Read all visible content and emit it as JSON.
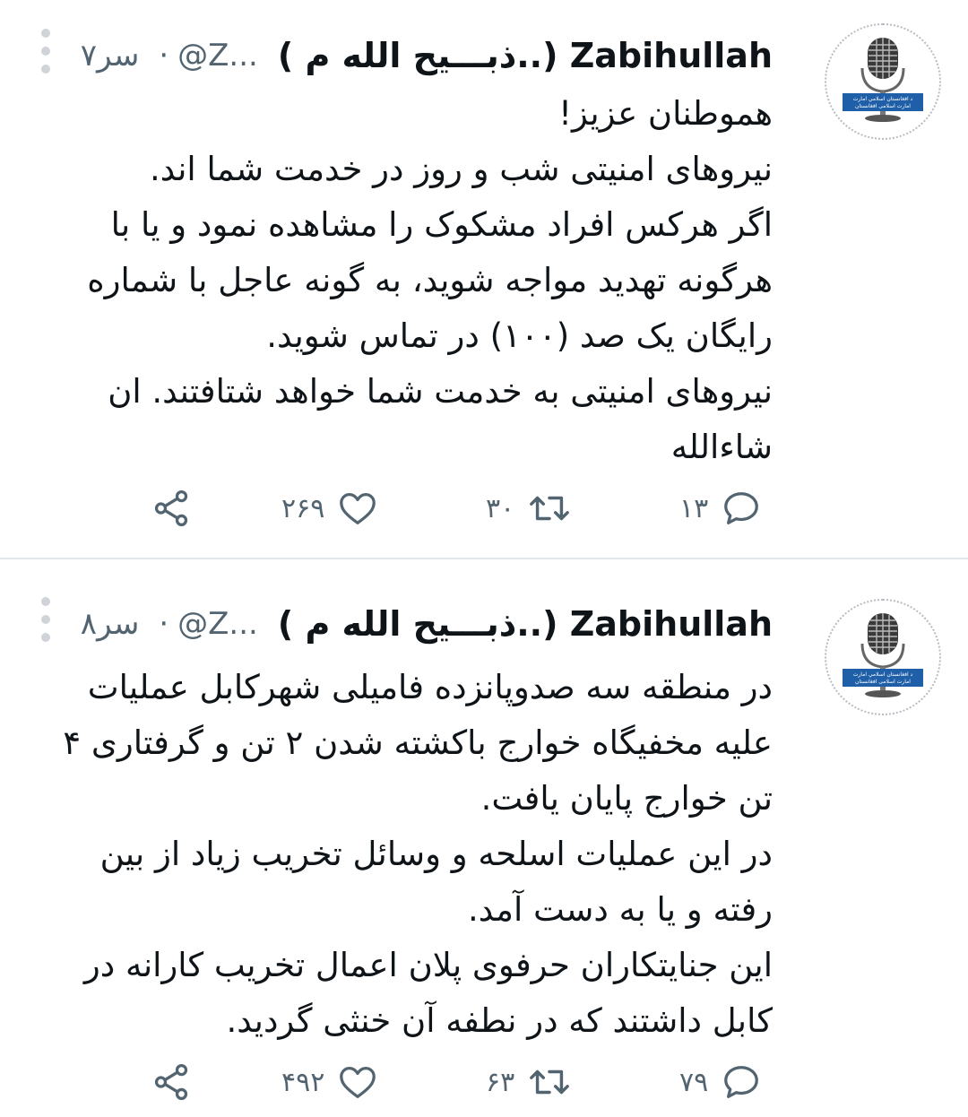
{
  "tweets": [
    {
      "display_name": "( ذبـــیح الله م..) Zabihullah",
      "handle": "@Z...",
      "time": "۷سر",
      "dot": "·",
      "body": [
        "هموطنان عزیز!",
        "نیروهای امنیتی شب و روز در خدمت شما اند.",
        "اگر هرکس افراد مشکوک را مشاهده نمود و یا با هرگونه تهدید مواجه شوید، به گونه عاجل با شماره رایگان یک صد (۱۰۰) در تماس شوید.",
        "نیروهای امنیتی به خدمت شما خواهد شتافتند. ان شاءالله"
      ],
      "replies": "۱۳",
      "retweets": "۳۰",
      "likes": "۲۶۹"
    },
    {
      "display_name": "( ذبـــیح الله م..) Zabihullah",
      "handle": "@Z...",
      "time": "۸سر",
      "dot": "·",
      "body": [
        "در منطقه سه صدوپانزده فامیلی شهرکابل عملیات علیه مخفیگاه خوارج باکشته شدن ۲ تن و گرفتاری ۴ تن خوارج پایان یافت.",
        "در این عملیات اسلحه و وسائل تخریب زیاد از بین رفته و یا به دست آمد.",
        "این جنایتکاران حرفوی پلان اعمال تخریب کارانه در کابل داشتند که در نطفه آن خنثی گردید."
      ],
      "replies": "۷۹",
      "retweets": "۶۳",
      "likes": "۴۹۲"
    }
  ],
  "avatar": {
    "banner_line_1": "د افغانستان اسلامي امارت",
    "banner_line_2": "امارت اسلامی افغانستان",
    "banner_color": "#1f5fa8"
  },
  "icons": {
    "reply": "reply-icon",
    "retweet": "retweet-icon",
    "like": "heart-icon",
    "share": "share-icon",
    "more": "more-dots-icon"
  }
}
